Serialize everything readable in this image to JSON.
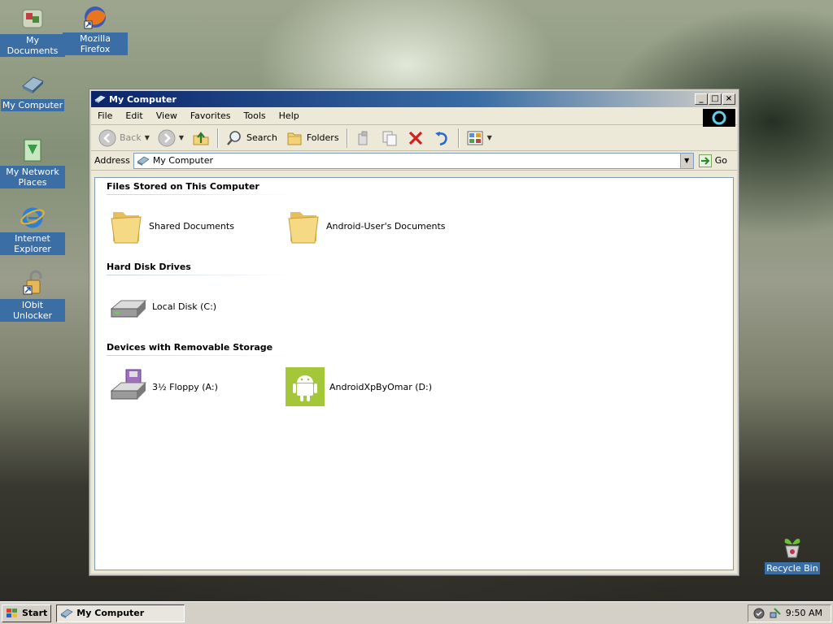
{
  "desktop": {
    "icons": [
      {
        "label": "My Documents",
        "icon": "my-documents-icon"
      },
      {
        "label": "Mozilla Firefox",
        "icon": "firefox-icon"
      },
      {
        "label": "My Computer",
        "icon": "my-computer-icon"
      },
      {
        "label": "My Network Places",
        "icon": "network-places-icon"
      },
      {
        "label": "Internet Explorer",
        "icon": "internet-explorer-icon"
      },
      {
        "label": "IObit Unlocker",
        "icon": "unlocker-icon"
      },
      {
        "label": "Recycle Bin",
        "icon": "recycle-bin-icon"
      }
    ]
  },
  "window": {
    "title": "My Computer",
    "menu": [
      "File",
      "Edit",
      "View",
      "Favorites",
      "Tools",
      "Help"
    ],
    "toolbar": {
      "back": "Back",
      "search": "Search",
      "folders": "Folders"
    },
    "address": {
      "label": "Address",
      "value": "My Computer",
      "go": "Go"
    },
    "groups": [
      {
        "header": "Files Stored on This Computer",
        "items": [
          "Shared Documents",
          "Android-User's Documents"
        ]
      },
      {
        "header": "Hard Disk Drives",
        "items": [
          "Local Disk (C:)"
        ]
      },
      {
        "header": "Devices with Removable Storage",
        "items": [
          "3½ Floppy (A:)",
          "AndroidXpByOmar (D:)"
        ]
      }
    ]
  },
  "taskbar": {
    "start": "Start",
    "task": "My Computer",
    "clock": "9:50 AM"
  },
  "colors": {
    "title_active": "#0a246a",
    "selection": "#3b6ea5",
    "android_green": "#a4c639",
    "folder_yellow": "#f3d27a"
  }
}
